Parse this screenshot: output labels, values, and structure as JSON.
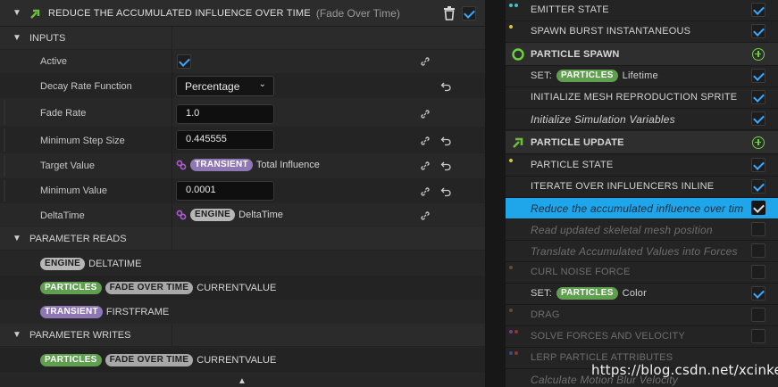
{
  "module": {
    "title": "REDUCE THE ACCUMULATED INFLUENCE OVER TIME",
    "subtitle": "(Fade Over Time)",
    "enabled": true
  },
  "sections": {
    "inputs": "INPUTS",
    "parameter_reads": "PARAMETER READS",
    "parameter_writes": "PARAMETER WRITES"
  },
  "inputs": {
    "active": {
      "label": "Active",
      "checked": true
    },
    "decay_rate_function": {
      "label": "Decay Rate Function",
      "value": "Percentage"
    },
    "fade_rate": {
      "label": "Fade Rate",
      "value": "1.0"
    },
    "minimum_step_size": {
      "label": "Minimum Step Size",
      "value": "0.445555"
    },
    "target_value": {
      "label": "Target Value",
      "namespace": "TRANSIENT",
      "value": "Total Influence"
    },
    "minimum_value": {
      "label": "Minimum Value",
      "value": "0.0001"
    },
    "delta_time": {
      "label": "DeltaTime",
      "namespace": "ENGINE",
      "value": "DeltaTime"
    }
  },
  "parameter_reads": [
    {
      "tags": [
        "ENGINE"
      ],
      "name": "DELTATIME"
    },
    {
      "tags": [
        "PARTICLES",
        "FADE OVER TIME"
      ],
      "name": "CURRENTVALUE"
    },
    {
      "tags": [
        "TRANSIENT"
      ],
      "name": "FIRSTFRAME"
    }
  ],
  "parameter_writes": [
    {
      "tags": [
        "PARTICLES",
        "FADE OVER TIME"
      ],
      "name": "CURRENTVALUE"
    }
  ],
  "stack": {
    "emitter_state": "EMITTER STATE",
    "spawn_burst": "SPAWN BURST INSTANTANEOUS",
    "particle_spawn": "PARTICLE SPAWN",
    "set_lifetime": {
      "prefix": "SET:",
      "tag": "PARTICLES",
      "name": "Lifetime"
    },
    "init_mesh_sprite": "INITIALIZE MESH REPRODUCTION SPRITE",
    "init_sim_vars": "Initialize Simulation Variables",
    "particle_update": "PARTICLE UPDATE",
    "particle_state": "PARTICLE STATE",
    "iterate_influencers": "ITERATE OVER INFLUENCERS INLINE",
    "reduce_influence": "Reduce the accumulated influence over tim",
    "read_skeletal": "Read updated skeletal mesh position",
    "translate_values": "Translate Accumulated Values into Forces",
    "curl_noise": "CURL NOISE FORCE",
    "set_color": {
      "prefix": "SET:",
      "tag": "PARTICLES",
      "name": "Color"
    },
    "drag": "DRAG",
    "solve_forces": "SOLVE FORCES AND VELOCITY",
    "lerp_attrs": "LERP PARTICLE ATTRIBUTES",
    "motion_blur": "Calculate Motion Blur Velocity"
  },
  "watermark": "https://blog.csdn.net/xcinkey",
  "colors": {
    "accent": "#1fa5ea",
    "particles_tag": "#5f9f4f",
    "transient_tag": "#8f77b5",
    "engine_tag": "#b7b7b7",
    "add_green": "#6bd43a"
  }
}
